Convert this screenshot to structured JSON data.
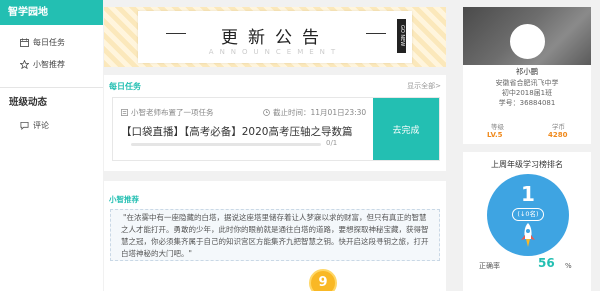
{
  "sidebar": {
    "header": "智学园地",
    "items": [
      {
        "label": "每日任务",
        "icon": "calendar-icon"
      },
      {
        "label": "小智推荐",
        "icon": "star-icon"
      }
    ],
    "section": "班级动态",
    "section_items": [
      {
        "label": "评论",
        "icon": "comment-icon"
      }
    ]
  },
  "banner": {
    "title": "更新公告",
    "subtitle": "ANNOUNCEMENT",
    "tag": "GO NEW"
  },
  "task_panel": {
    "title": "每日任务",
    "more": "显示全部>",
    "task": {
      "meta": "小智老师布置了一项任务",
      "deadline": "截止时间：11月01日23:30",
      "name": "【口袋直播】【高考必备】2020高考压轴之导数篇",
      "progress": 0,
      "count": "0/1",
      "button": "去完成"
    }
  },
  "recommend": {
    "title": "小智推荐",
    "text": "\"在浓雾中有一座隐藏的白塔，据说这座塔里储存着让人梦寐以求的财富，但只有真正的智慧之人才能打开。勇敢的少年，此时你的眼前就是通往白塔的道路，要想探取神秘宝藏，获得智慧之冠，你必须集齐属于自己的知识宫区方能集齐九把智慧之钥。快开启这段寻钥之旅，打开白塔神秘的大门吧。\"",
    "badge": "9"
  },
  "profile": {
    "name": "祁小鹏",
    "school": "安徽省合肥讯飞中学",
    "class": "初中2018届1班",
    "student_id": "学号：36884081",
    "level_label": "等级",
    "level_value": "LV.5",
    "coins_label": "学币",
    "coins_value": "4280"
  },
  "ranking": {
    "title": "上周年级学习榜排名",
    "rank": "1",
    "delta": "(↓0名)",
    "accuracy_label": "正确率",
    "accuracy_value": "56",
    "accuracy_unit": "%"
  },
  "colors": {
    "accent": "#23bfb2",
    "rank_blue": "#3ea4e2",
    "coin_orange": "#f08a1d"
  }
}
